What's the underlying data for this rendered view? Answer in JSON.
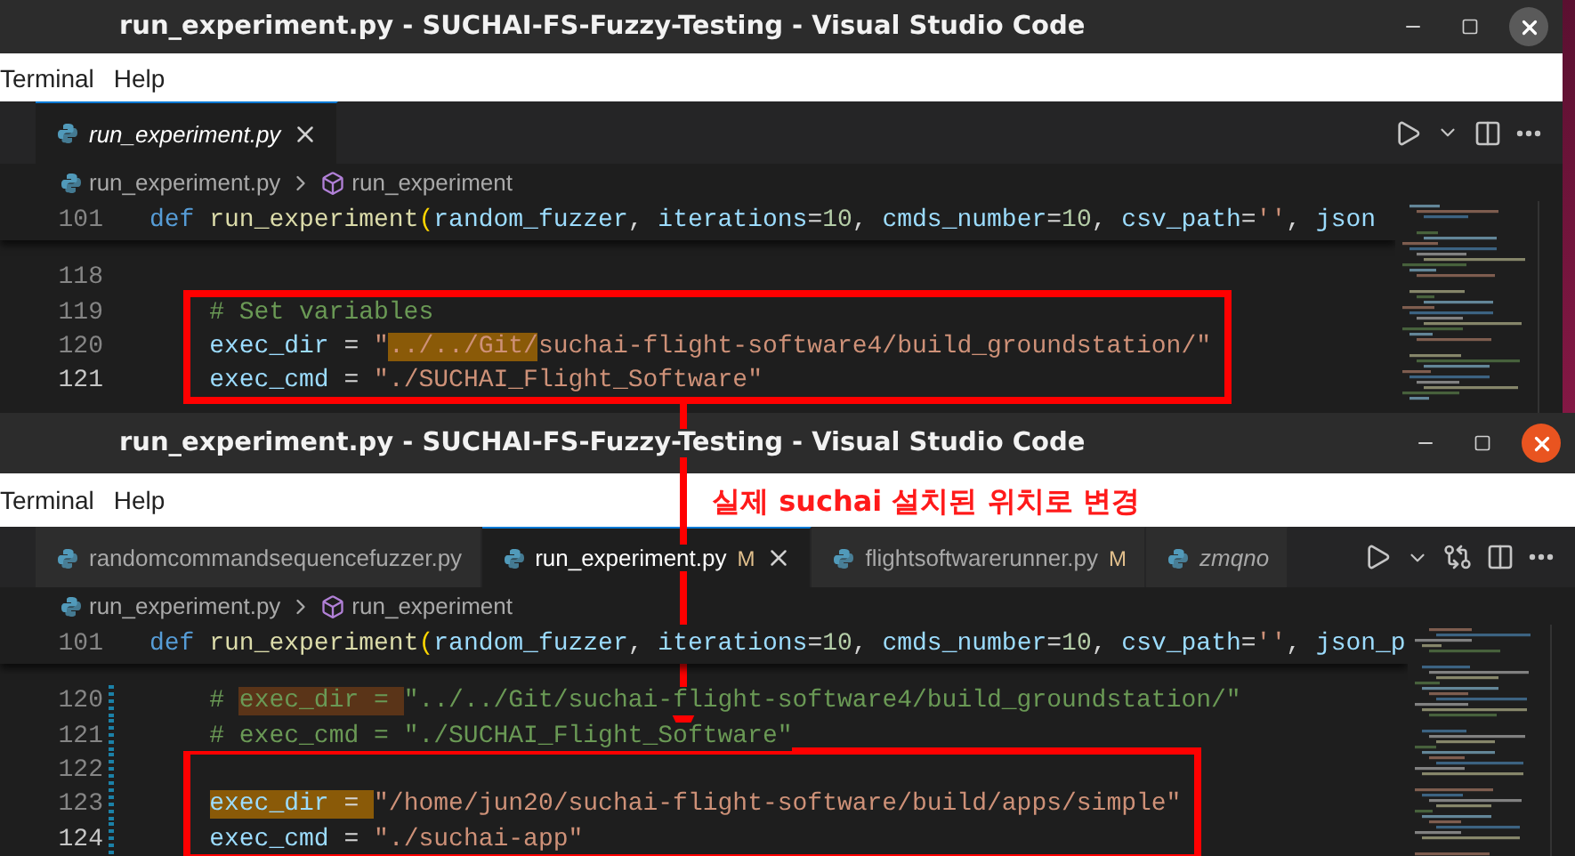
{
  "windows": [
    {
      "title": "run_experiment.py - SUCHAI-FS-Fuzzy-Testing - Visual Studio Code",
      "focused": false,
      "menu": [
        "Terminal",
        "Help"
      ],
      "tabs": [
        {
          "label": "run_experiment.py",
          "selected": true,
          "preview": true
        }
      ],
      "actions": [
        {
          "kind": "run"
        },
        {
          "kind": "dropdown"
        },
        {
          "kind": "split"
        },
        {
          "kind": "more"
        }
      ],
      "breadcrumb": {
        "file": "run_experiment.py",
        "symbol": "run_experiment"
      },
      "sticky": {
        "number": "101",
        "tokens": [
          {
            "kind": "kw",
            "text": "def "
          },
          {
            "kind": "fn",
            "text": "run_experiment"
          },
          {
            "kind": "bracket",
            "text": "("
          },
          {
            "kind": "var",
            "text": "random_fuzzer"
          },
          {
            "kind": "plain",
            "text": ", "
          },
          {
            "kind": "var",
            "text": "iterations"
          },
          {
            "kind": "plain",
            "text": "="
          },
          {
            "kind": "num",
            "text": "10"
          },
          {
            "kind": "plain",
            "text": ", "
          },
          {
            "kind": "var",
            "text": "cmds_number"
          },
          {
            "kind": "plain",
            "text": "="
          },
          {
            "kind": "num",
            "text": "10"
          },
          {
            "kind": "plain",
            "text": ", "
          },
          {
            "kind": "var",
            "text": "csv_path"
          },
          {
            "kind": "plain",
            "text": "="
          },
          {
            "kind": "str",
            "text": "''"
          },
          {
            "kind": "plain",
            "text": ", "
          },
          {
            "kind": "var",
            "text": "json"
          }
        ]
      },
      "lines": [
        {
          "kind": "line",
          "number": "118",
          "current": false,
          "changed": false
        },
        {
          "kind": "box",
          "lines": [
            {
              "number": "119",
              "current": false,
              "changed": false,
              "tokens": [
                {
                  "kind": "cmt",
                  "text": "# Set variables"
                }
              ]
            },
            {
              "number": "120",
              "current": false,
              "changed": false,
              "tokens": [
                {
                  "kind": "var",
                  "text": "exec_dir"
                },
                {
                  "kind": "plain",
                  "text": " = "
                },
                {
                  "kind": "str",
                  "text": "\""
                },
                {
                  "kind": "str",
                  "text": "../../Git/",
                  "highlighted": true
                },
                {
                  "kind": "str",
                  "text": "suchai-flight-software4/build_groundstation/\""
                }
              ]
            },
            {
              "number": "121",
              "current": true,
              "changed": false,
              "tokens": [
                {
                  "kind": "var",
                  "text": "exec_cmd"
                },
                {
                  "kind": "plain",
                  "text": " = "
                },
                {
                  "kind": "str",
                  "text": "\"./SUCHAI_Flight_Software\""
                }
              ]
            }
          ]
        }
      ]
    },
    {
      "title": "run_experiment.py - SUCHAI-FS-Fuzzy-Testing - Visual Studio Code",
      "focused": true,
      "menu": [
        "Terminal",
        "Help"
      ],
      "tabs": [
        {
          "label": "randomcommandsequencefuzzer.py",
          "selected": false,
          "preview": false
        },
        {
          "label": "run_experiment.py",
          "badge": "M",
          "selected": true,
          "preview": false
        },
        {
          "label": "flightsoftwarerunner.py",
          "badge": "M",
          "selected": false,
          "preview": false
        },
        {
          "label": "zmqno",
          "selected": false,
          "preview": true
        }
      ],
      "actions": [
        {
          "kind": "run"
        },
        {
          "kind": "dropdown"
        },
        {
          "kind": "compare"
        },
        {
          "kind": "split"
        },
        {
          "kind": "more"
        }
      ],
      "breadcrumb": {
        "file": "run_experiment.py",
        "symbol": "run_experiment"
      },
      "sticky": {
        "number": "101",
        "tokens": [
          {
            "kind": "kw",
            "text": "def "
          },
          {
            "kind": "fn",
            "text": "run_experiment"
          },
          {
            "kind": "bracket",
            "text": "("
          },
          {
            "kind": "var",
            "text": "random_fuzzer"
          },
          {
            "kind": "plain",
            "text": ", "
          },
          {
            "kind": "var",
            "text": "iterations"
          },
          {
            "kind": "plain",
            "text": "="
          },
          {
            "kind": "num",
            "text": "10"
          },
          {
            "kind": "plain",
            "text": ", "
          },
          {
            "kind": "var",
            "text": "cmds_number"
          },
          {
            "kind": "plain",
            "text": "="
          },
          {
            "kind": "num",
            "text": "10"
          },
          {
            "kind": "plain",
            "text": ", "
          },
          {
            "kind": "var",
            "text": "csv_path"
          },
          {
            "kind": "plain",
            "text": "="
          },
          {
            "kind": "str",
            "text": "''"
          },
          {
            "kind": "plain",
            "text": ", "
          },
          {
            "kind": "var",
            "text": "json_p"
          }
        ]
      },
      "lines": [
        {
          "kind": "line",
          "number": "120",
          "current": false,
          "changed": true,
          "tokens": [
            {
              "kind": "cmt",
              "text": "    # "
            },
            {
              "kind": "cmt",
              "text": "exec_dir = ",
              "faint_highlight": true
            },
            {
              "kind": "cmt",
              "text": "\"../../Git/suchai-flight-software4/build_groundstation/\""
            }
          ]
        },
        {
          "kind": "line",
          "number": "121",
          "current": false,
          "changed": true,
          "tokens": [
            {
              "kind": "cmt",
              "text": "    # exec_cmd = \"./SUCHAI_Flight_Software\""
            }
          ]
        },
        {
          "kind": "box",
          "lines": [
            {
              "number": "122",
              "current": false,
              "changed": true
            },
            {
              "number": "123",
              "current": false,
              "changed": true,
              "tokens": [
                {
                  "kind": "var",
                  "text": "exec_dir",
                  "highlighted": true
                },
                {
                  "kind": "plain",
                  "text": " = ",
                  "highlighted": true
                },
                {
                  "kind": "str",
                  "text": "\"/home/jun20/suchai-flight-software/build/apps/simple\""
                }
              ]
            },
            {
              "number": "124",
              "current": true,
              "changed": true,
              "tokens": [
                {
                  "kind": "var",
                  "text": "exec_cmd"
                },
                {
                  "kind": "plain",
                  "text": " = "
                },
                {
                  "kind": "str",
                  "text": "\"./suchai-app\""
                }
              ]
            }
          ]
        }
      ]
    }
  ],
  "annotation": {
    "note": "실제 suchai 설치된 위치로 변경"
  }
}
